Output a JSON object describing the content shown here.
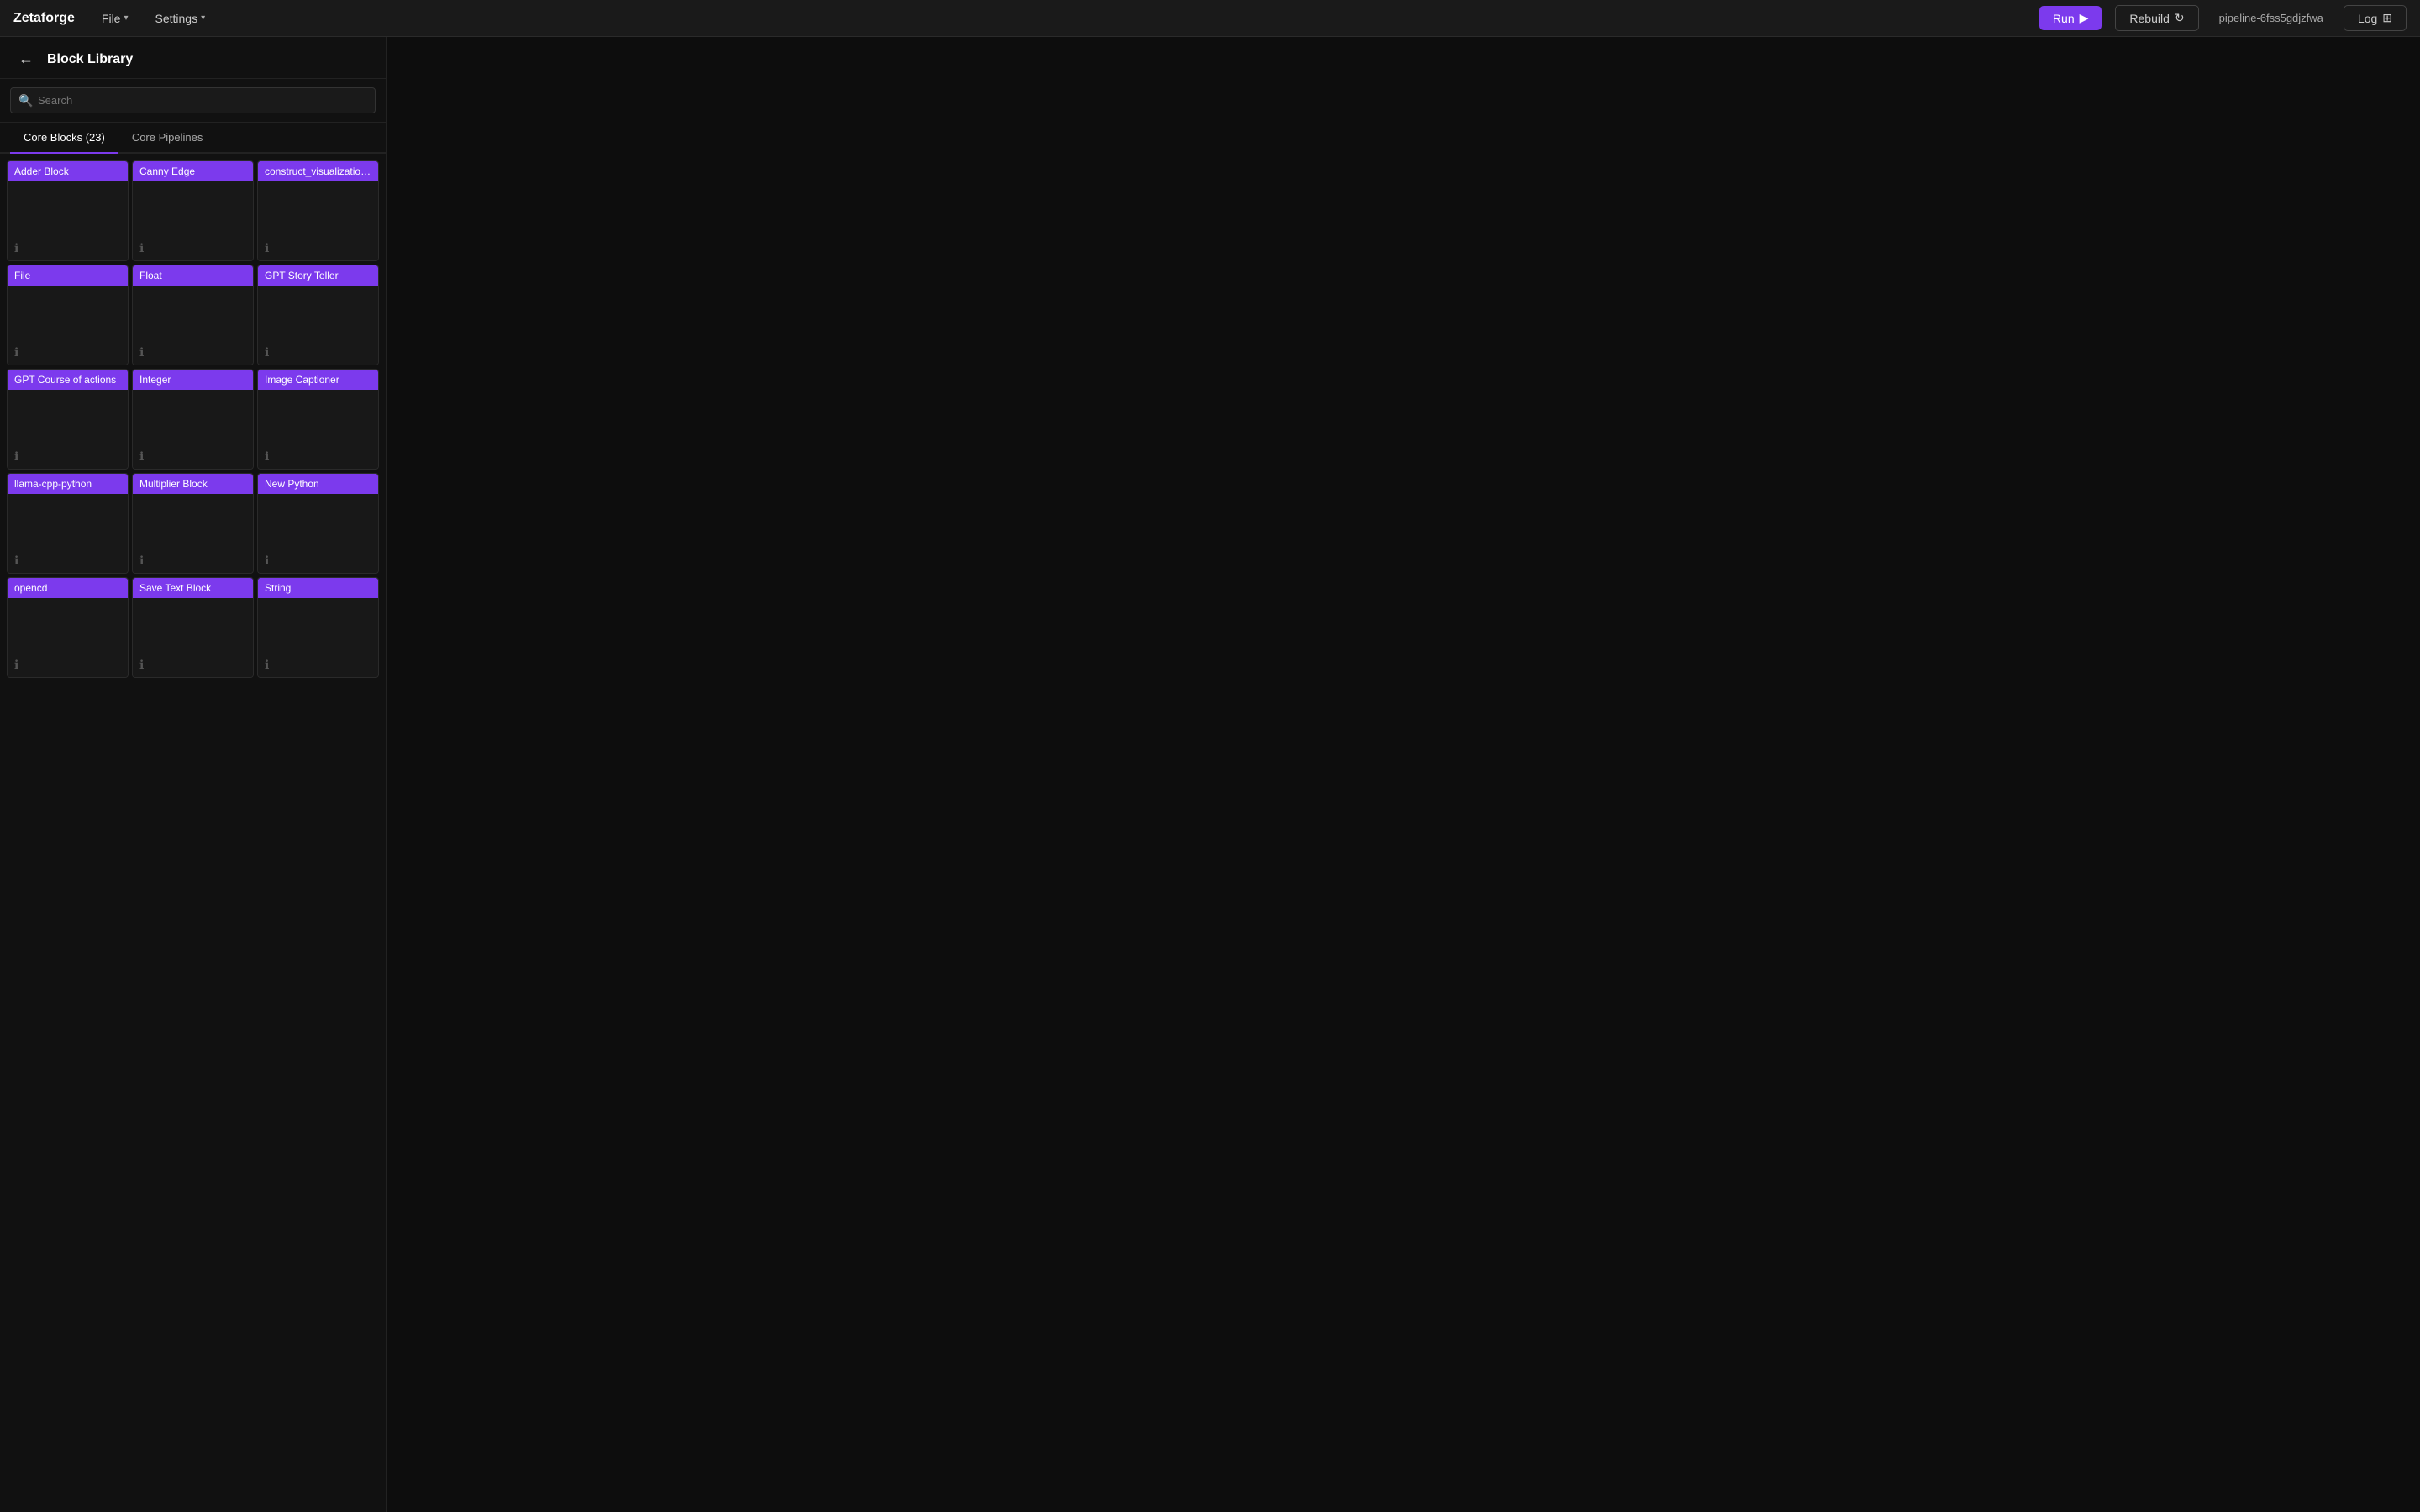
{
  "app": {
    "name": "Zetaforge"
  },
  "topbar": {
    "file_label": "File",
    "settings_label": "Settings",
    "run_label": "Run",
    "rebuild_label": "Rebuild",
    "pipeline_id": "pipeline-6fss5gdjzfwa",
    "log_label": "Log"
  },
  "sidebar": {
    "title": "Block Library",
    "search_placeholder": "Search",
    "tabs": [
      {
        "label": "Core Blocks (23)",
        "active": true
      },
      {
        "label": "Core Pipelines",
        "active": false
      }
    ],
    "blocks": [
      {
        "label": "Adder Block"
      },
      {
        "label": "Canny Edge"
      },
      {
        "label": "construct_visualization_data"
      },
      {
        "label": "File"
      },
      {
        "label": "Float"
      },
      {
        "label": "GPT Story Teller"
      },
      {
        "label": "GPT Course of actions"
      },
      {
        "label": "Integer"
      },
      {
        "label": "Image Captioner"
      },
      {
        "label": "llama-cpp-python"
      },
      {
        "label": "Multiplier Block"
      },
      {
        "label": "New Python"
      },
      {
        "label": "opencd"
      },
      {
        "label": "Save Text Block"
      },
      {
        "label": "String"
      }
    ]
  }
}
